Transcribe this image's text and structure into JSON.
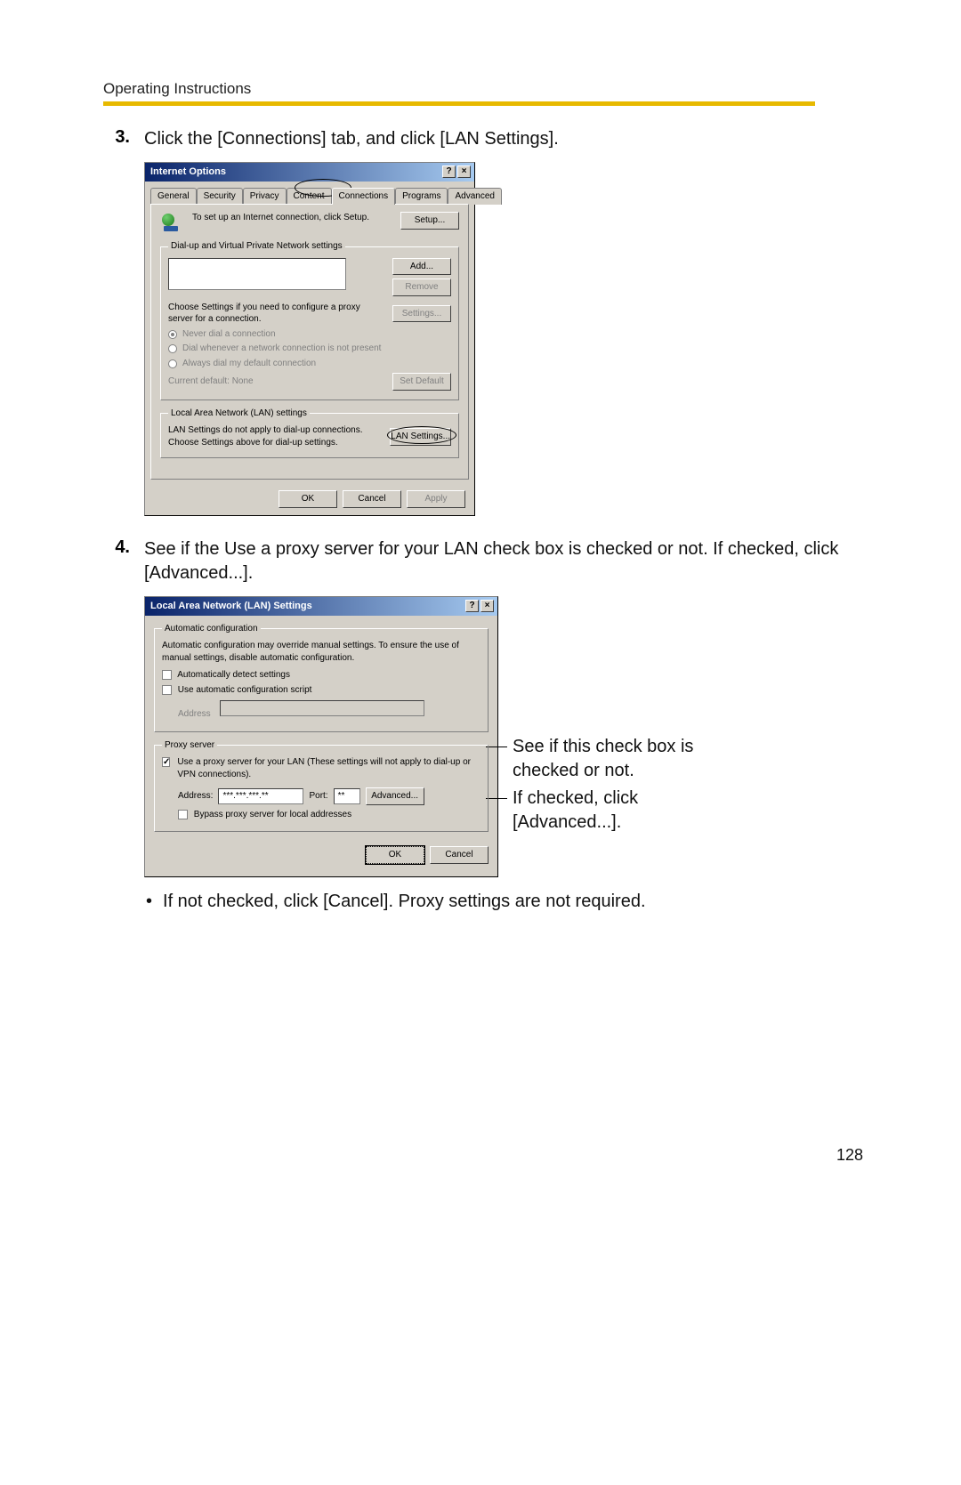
{
  "header": {
    "title": "Operating Instructions"
  },
  "steps": {
    "s3": {
      "num": "3.",
      "text": "Click the [Connections] tab, and click [LAN Settings]."
    },
    "s4": {
      "num": "4.",
      "text": "See if the Use a proxy server for your LAN check box is checked or not. If checked, click [Advanced...]."
    }
  },
  "dlg1": {
    "title": "Internet Options",
    "tabs": {
      "general": "General",
      "security": "Security",
      "privacy": "Privacy",
      "content": "Content",
      "connections": "Connections",
      "programs": "Programs",
      "advanced": "Advanced"
    },
    "setupText": "To set up an Internet connection, click Setup.",
    "setupBtn": "Setup...",
    "dialupLegend": "Dial-up and Virtual Private Network settings",
    "addBtn": "Add...",
    "removeBtn": "Remove",
    "settingsHint": "Choose Settings if you need to configure a proxy server for a connection.",
    "settingsBtn": "Settings...",
    "r1": "Never dial a connection",
    "r2": "Dial whenever a network connection is not present",
    "r3": "Always dial my default connection",
    "currentDefault": "Current default:    None",
    "setDefaultBtn": "Set Default",
    "lanLegend": "Local Area Network (LAN) settings",
    "lanHint": "LAN Settings do not apply to dial-up connections. Choose Settings above for dial-up settings.",
    "lanBtn": "LAN Settings...",
    "ok": "OK",
    "cancel": "Cancel",
    "apply": "Apply"
  },
  "dlg2": {
    "title": "Local Area Network (LAN) Settings",
    "autoLegend": "Automatic configuration",
    "autoText": "Automatic configuration may override manual settings.  To ensure the use of manual settings, disable automatic configuration.",
    "autoDetect": "Automatically detect settings",
    "useScript": "Use automatic configuration script",
    "addressLbl": "Address",
    "proxyLegend": "Proxy server",
    "useProxy": "Use a proxy server for your LAN (These settings will not apply to dial-up or VPN connections).",
    "addr2Lbl": "Address:",
    "addr2Val": "***.***.***.**",
    "portLbl": "Port:",
    "portVal": "**",
    "advancedBtn": "Advanced...",
    "bypass": "Bypass proxy server for local addresses",
    "ok": "OK",
    "cancel": "Cancel"
  },
  "annot": {
    "line1": "See if this check box is checked or not.",
    "line2": "If checked, click [Advanced...]."
  },
  "bullet": {
    "text": "If not checked, click [Cancel]. Proxy settings are not required."
  },
  "pageNum": "128"
}
